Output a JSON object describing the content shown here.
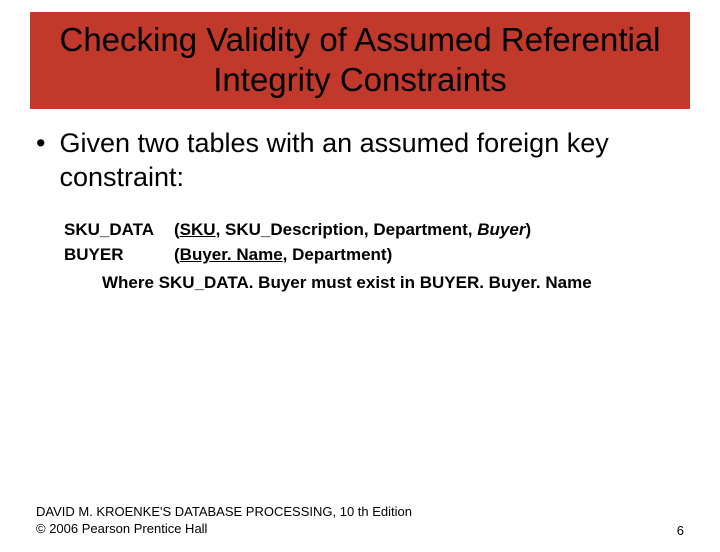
{
  "title": "Checking Validity of Assumed Referential Integrity Constraints",
  "bullet": "•",
  "intro": "Given two tables with an assumed foreign key constraint:",
  "schema": {
    "row1": {
      "table": "SKU_DATA",
      "open": "(",
      "pk": "SKU",
      "mid": ", SKU_Description, Department, ",
      "fk": "Buyer",
      "close": ")"
    },
    "row2": {
      "table": "BUYER",
      "open": "(",
      "pk": "Buyer. Name",
      "rest": ", Department)"
    },
    "where": "Where SKU_DATA. Buyer must exist in BUYER. Buyer. Name"
  },
  "footer": {
    "line1": "DAVID M. KROENKE'S DATABASE PROCESSING, 10 th Edition",
    "line2": "© 2006 Pearson Prentice Hall",
    "page": "6"
  }
}
